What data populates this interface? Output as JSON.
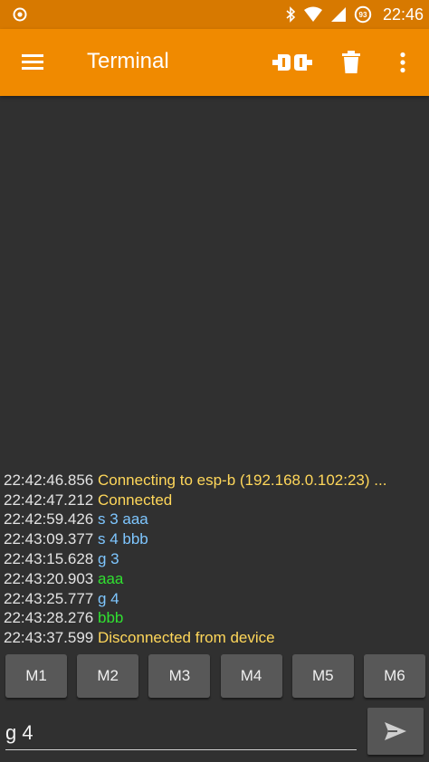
{
  "status_bar": {
    "time": "22:46",
    "battery_level": "93",
    "icons": [
      "record-icon",
      "bluetooth-icon",
      "wifi-icon",
      "signal-icon",
      "battery-icon"
    ]
  },
  "app_bar": {
    "title": "Terminal",
    "actions": [
      "connect-icon",
      "delete-icon",
      "more-vert-icon"
    ],
    "color": "#f08a00"
  },
  "colors": {
    "status": "#ffd75a",
    "sent": "#7ec6ff",
    "received": "#30e030",
    "timestamp": "#e2e2e2"
  },
  "log": [
    {
      "time": "22:42:46.856",
      "text": "Connecting to esp-b (192.168.0.102:23) ...",
      "kind": "status"
    },
    {
      "time": "22:42:47.212",
      "text": "Connected",
      "kind": "status"
    },
    {
      "time": "22:42:59.426",
      "text": "s 3 aaa",
      "kind": "sent"
    },
    {
      "time": "22:43:09.377",
      "text": "s 4 bbb",
      "kind": "sent"
    },
    {
      "time": "22:43:15.628",
      "text": "g 3",
      "kind": "sent"
    },
    {
      "time": "22:43:20.903",
      "text": "aaa",
      "kind": "received"
    },
    {
      "time": "22:43:25.777",
      "text": "g 4",
      "kind": "sent"
    },
    {
      "time": "22:43:28.276",
      "text": "bbb",
      "kind": "received"
    },
    {
      "time": "22:43:37.599",
      "text": "Disconnected from device",
      "kind": "status"
    }
  ],
  "macros": [
    "M1",
    "M2",
    "M3",
    "M4",
    "M5",
    "M6"
  ],
  "input": {
    "value": "g 4"
  }
}
